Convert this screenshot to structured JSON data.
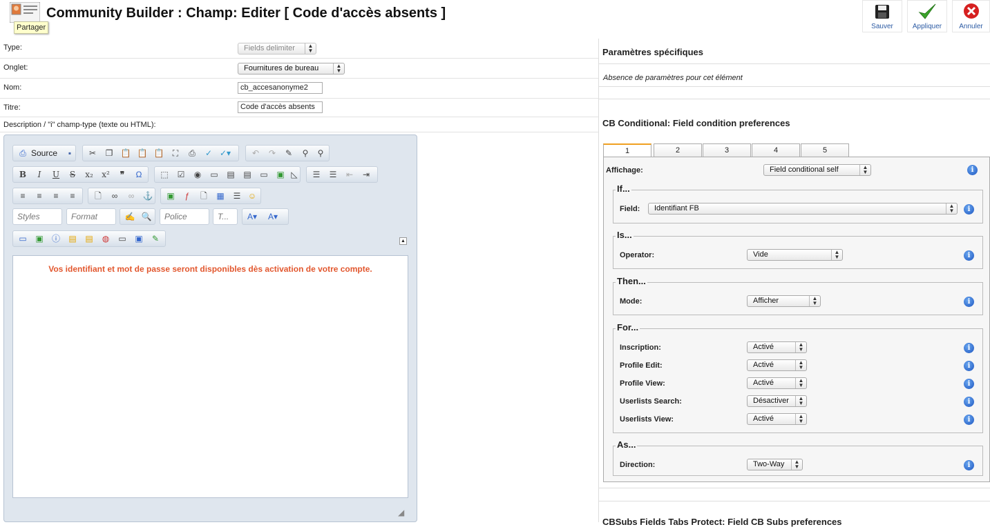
{
  "header": {
    "title": "Community Builder : Champ: Editer [ Code d'accès absents ]",
    "tooltip": "Partager",
    "buttons": [
      {
        "label": "Sauver",
        "icon": "floppy-disk-icon"
      },
      {
        "label": "Appliquer",
        "icon": "checkmark-icon"
      },
      {
        "label": "Annuler",
        "icon": "cancel-icon"
      }
    ]
  },
  "form": {
    "type_label": "Type:",
    "type_value": "Fields delimiter",
    "tab_label": "Onglet:",
    "tab_value": "Fournitures de bureau",
    "name_label": "Nom:",
    "name_value": "cb_accesanonyme2",
    "title_label": "Titre:",
    "title_value": "Code d'accès absents",
    "desc_label": "Description / \"i\" champ-type (texte ou HTML):"
  },
  "editor": {
    "source_label": "Source",
    "combos": {
      "styles": "Styles",
      "format": "Format",
      "police": "Police",
      "taille": "T..."
    },
    "content": "Vos identifiant et mot de passe seront disponibles dès activation de votre compte."
  },
  "right": {
    "params_title": "Paramètres spécifiques",
    "params_empty": "Absence de paramètres pour cet élément",
    "cond_title": "CB Conditional: Field condition preferences",
    "tabs": [
      "1",
      "2",
      "3",
      "4",
      "5"
    ],
    "affichage_label": "Affichage:",
    "affichage_value": "Field conditional self",
    "if_legend": "If...",
    "field_label": "Field:",
    "field_value": "Identifiant FB",
    "is_legend": "Is...",
    "operator_label": "Operator:",
    "operator_value": "Vide",
    "then_legend": "Then...",
    "mode_label": "Mode:",
    "mode_value": "Afficher",
    "for_legend": "For...",
    "for_rows": [
      {
        "label": "Inscription:",
        "value": "Activé"
      },
      {
        "label": "Profile Edit:",
        "value": "Activé"
      },
      {
        "label": "Profile View:",
        "value": "Activé"
      },
      {
        "label": "Userlists Search:",
        "value": "Désactiver"
      },
      {
        "label": "Userlists View:",
        "value": "Activé"
      }
    ],
    "as_legend": "As...",
    "direction_label": "Direction:",
    "direction_value": "Two-Way",
    "cbsubs_title": "CBSubs Fields Tabs Protect: Field CB Subs preferences"
  }
}
